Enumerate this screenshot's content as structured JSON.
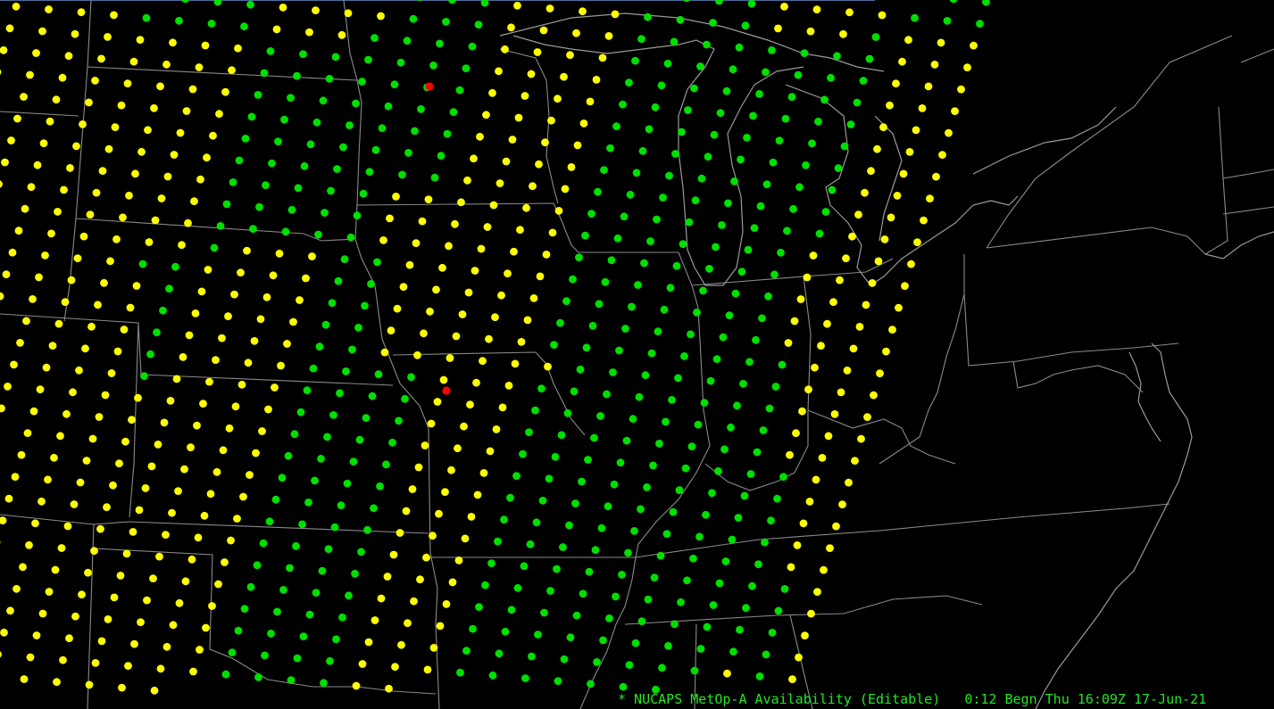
{
  "colors": {
    "background": "#000000",
    "border": "#8a8a8a",
    "coast": "#9a9a9a",
    "status_text": "#22e622",
    "point_available": "#00e000",
    "point_expected": "#ffff00",
    "point_flagged": "#ff0000"
  },
  "product": {
    "name": "NUCAPS MetOp-A Availability",
    "status_line": "* NUCAPS MetOp-A Availability (Editable)   0:12 Begn Thu 16:09Z 17-Jun-21",
    "swath_orientation": "north-northeast",
    "point_legend": [
      {
        "status": "available",
        "color": "#00e000"
      },
      {
        "status": "expected",
        "color": "#ffff00"
      },
      {
        "status": "flagged",
        "color": "#ff0000"
      }
    ]
  },
  "map": {
    "region": "Central and Eastern United States",
    "background": "black",
    "layers": [
      "state-borders",
      "coastlines",
      "great-lakes"
    ]
  }
}
